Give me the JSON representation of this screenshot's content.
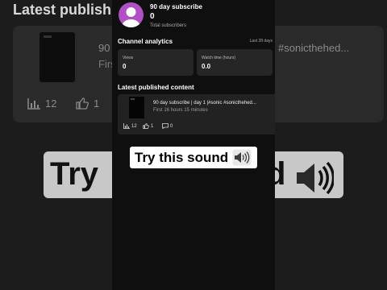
{
  "background": {
    "section_title": "Latest publish",
    "video_title_fragment": "90",
    "video_time_fragment": "First",
    "hashtag_fragment": "#sonicthehed...",
    "views_count": "12",
    "likes_count": "1",
    "overlay_text": "Try",
    "overlay_text_end": "d"
  },
  "channel": {
    "name": "90 day subscribe",
    "subscriber_count": "0",
    "subscriber_label": "Total subscribers",
    "avatar_color": "#b14fc4"
  },
  "analytics": {
    "title": "Channel analytics",
    "range": "Last 28 days",
    "metrics": [
      {
        "label": "Views",
        "value": "0"
      },
      {
        "label": "Watch time (hours)",
        "value": "0.0"
      }
    ]
  },
  "latest": {
    "title": "Latest published content",
    "video": {
      "title": "90 day subscribe | day 1 |#sonic #sonicthehed...",
      "time": "First 16 hours 15 minutes",
      "views": "12",
      "likes": "1",
      "comments": "0"
    }
  },
  "overlay": {
    "text": "Try this sound",
    "icon": "speaker-icon"
  }
}
